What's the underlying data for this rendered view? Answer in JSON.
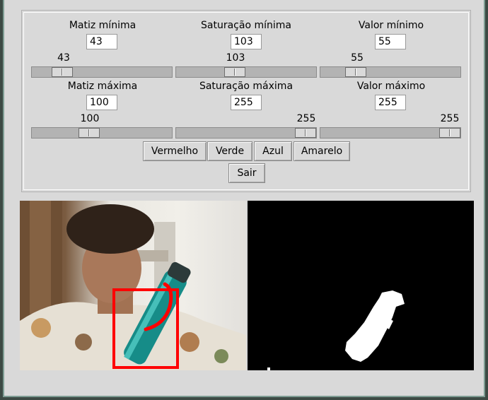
{
  "sliders": {
    "hue_min": {
      "label": "Matiz mínima",
      "entry": "43",
      "value": "43"
    },
    "sat_min": {
      "label": "Saturação mínima",
      "entry": "103",
      "value": "103"
    },
    "val_min": {
      "label": "Valor mínimo",
      "entry": "55",
      "value": "55"
    },
    "hue_max": {
      "label": "Matiz máxima",
      "entry": "100",
      "value": "100"
    },
    "sat_max": {
      "label": "Saturação máxima",
      "entry": "255",
      "value": "255"
    },
    "val_max": {
      "label": "Valor máximo",
      "entry": "255",
      "value": "255"
    }
  },
  "buttons": {
    "red": "Vermelho",
    "green": "Verde",
    "blue": "Azul",
    "yellow": "Amarelo",
    "quit": "Sair"
  },
  "colors": {
    "window_bg": "#d9d9d9",
    "detection_box": "#ff0000",
    "mask_bg": "#000000",
    "mask_fg": "#ffffff"
  }
}
